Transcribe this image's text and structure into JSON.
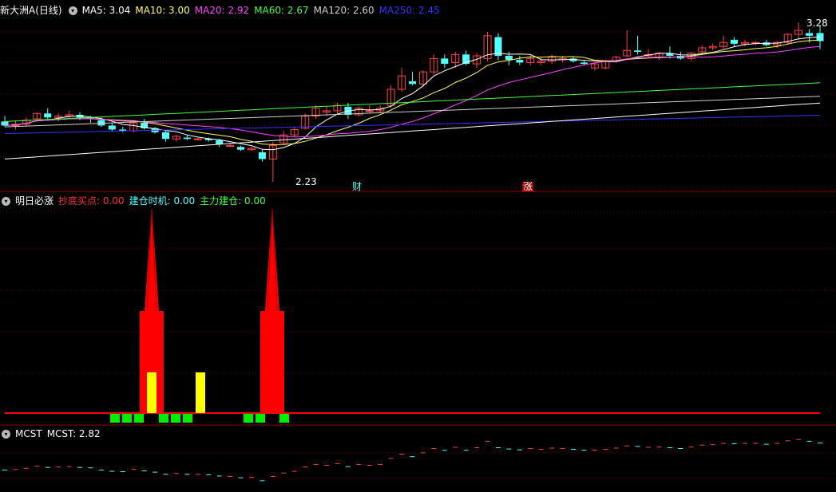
{
  "colors": {
    "bg": "#000000",
    "up": "#ff4444",
    "down": "#54ffff",
    "grid": "#6b0000",
    "ma5": "#ffffff",
    "ma10": "#ffff55",
    "ma20": "#ff44ff",
    "ma60": "#44ff44",
    "ma120": "#d0d0d0",
    "ma250": "#3333ff",
    "bar_red": "#ff0000",
    "bar_yellow": "#ffff00",
    "bar_green": "#00ee00"
  },
  "main": {
    "title": "新大洲A(日线)",
    "ma5": "MA5: 3.04",
    "ma10": "MA10: 3.00",
    "ma20": "MA20: 2.92",
    "ma60": "MA60: 2.67",
    "ma120": "MA120: 2.60",
    "ma250": "MA250: 2.45",
    "high_label": "3.28",
    "low_label": "2.23",
    "flag_cai": "财",
    "flag_zhang": "涨"
  },
  "indicator": {
    "title": "明日必涨",
    "chaodi": "抄底买点: 0.00",
    "jiancang": "建仓时机: 0.00",
    "zhuli": "主力建仓: 0.00"
  },
  "mcst": {
    "title": "MCST",
    "value": "MCST: 2.82"
  },
  "chart_data": {
    "type": "candlestick",
    "ohlc": [
      [
        2.68,
        2.72,
        2.64,
        2.65
      ],
      [
        2.65,
        2.69,
        2.62,
        2.66
      ],
      [
        2.66,
        2.71,
        2.64,
        2.69
      ],
      [
        2.7,
        2.75,
        2.68,
        2.74
      ],
      [
        2.74,
        2.78,
        2.7,
        2.71
      ],
      [
        2.71,
        2.74,
        2.68,
        2.72
      ],
      [
        2.72,
        2.76,
        2.7,
        2.73
      ],
      [
        2.73,
        2.75,
        2.69,
        2.71
      ],
      [
        2.71,
        2.72,
        2.67,
        2.7
      ],
      [
        2.69,
        2.71,
        2.64,
        2.65
      ],
      [
        2.65,
        2.67,
        2.61,
        2.62
      ],
      [
        2.62,
        2.64,
        2.6,
        2.61
      ],
      [
        2.61,
        2.68,
        2.6,
        2.67
      ],
      [
        2.67,
        2.7,
        2.62,
        2.63
      ],
      [
        2.63,
        2.64,
        2.59,
        2.6
      ],
      [
        2.6,
        2.61,
        2.53,
        2.55
      ],
      [
        2.55,
        2.58,
        2.53,
        2.57
      ],
      [
        2.56,
        2.58,
        2.54,
        2.55
      ],
      [
        2.55,
        2.56,
        2.54,
        2.55
      ],
      [
        2.55,
        2.56,
        2.53,
        2.54
      ],
      [
        2.54,
        2.55,
        2.49,
        2.51
      ],
      [
        2.5,
        2.52,
        2.49,
        2.5
      ],
      [
        2.49,
        2.5,
        2.46,
        2.47
      ],
      [
        2.47,
        2.49,
        2.46,
        2.48
      ],
      [
        2.45,
        2.47,
        2.38,
        2.4
      ],
      [
        2.4,
        2.53,
        2.23,
        2.5
      ],
      [
        2.52,
        2.61,
        2.51,
        2.58
      ],
      [
        2.58,
        2.64,
        2.56,
        2.62
      ],
      [
        2.63,
        2.74,
        2.62,
        2.72
      ],
      [
        2.72,
        2.8,
        2.7,
        2.78
      ],
      [
        2.75,
        2.79,
        2.72,
        2.76
      ],
      [
        2.76,
        2.82,
        2.74,
        2.8
      ],
      [
        2.79,
        2.82,
        2.7,
        2.73
      ],
      [
        2.73,
        2.79,
        2.72,
        2.78
      ],
      [
        2.76,
        2.8,
        2.74,
        2.76
      ],
      [
        2.76,
        2.8,
        2.74,
        2.78
      ],
      [
        2.8,
        2.95,
        2.78,
        2.92
      ],
      [
        2.92,
        3.08,
        2.9,
        3.02
      ],
      [
        2.98,
        3.05,
        2.95,
        2.96
      ],
      [
        2.96,
        3.06,
        2.94,
        3.05
      ],
      [
        3.05,
        3.18,
        3.03,
        3.15
      ],
      [
        3.15,
        3.18,
        3.08,
        3.11
      ],
      [
        3.12,
        3.2,
        3.08,
        3.18
      ],
      [
        3.18,
        3.21,
        3.1,
        3.11
      ],
      [
        3.11,
        3.19,
        3.08,
        3.17
      ],
      [
        3.15,
        3.35,
        3.13,
        3.32
      ],
      [
        3.31,
        3.34,
        3.14,
        3.17
      ],
      [
        3.17,
        3.2,
        3.1,
        3.14
      ],
      [
        3.14,
        3.17,
        3.1,
        3.12
      ],
      [
        3.12,
        3.18,
        3.1,
        3.15
      ],
      [
        3.12,
        3.16,
        3.1,
        3.13
      ],
      [
        3.13,
        3.18,
        3.11,
        3.16
      ],
      [
        3.14,
        3.17,
        3.12,
        3.15
      ],
      [
        3.15,
        3.16,
        3.12,
        3.13
      ],
      [
        3.12,
        3.14,
        3.1,
        3.11
      ],
      [
        3.08,
        3.12,
        3.06,
        3.11
      ],
      [
        3.08,
        3.14,
        3.07,
        3.13
      ],
      [
        3.13,
        3.17,
        3.12,
        3.16
      ],
      [
        3.17,
        3.36,
        3.16,
        3.21
      ],
      [
        3.21,
        3.32,
        3.18,
        3.2
      ],
      [
        3.17,
        3.22,
        3.15,
        3.18
      ],
      [
        3.16,
        3.2,
        3.14,
        3.19
      ],
      [
        3.19,
        3.24,
        3.15,
        3.17
      ],
      [
        3.17,
        3.2,
        3.14,
        3.15
      ],
      [
        3.15,
        3.2,
        3.13,
        3.19
      ],
      [
        3.2,
        3.25,
        3.18,
        3.23
      ],
      [
        3.23,
        3.26,
        3.21,
        3.24
      ],
      [
        3.24,
        3.32,
        3.22,
        3.27
      ],
      [
        3.29,
        3.31,
        3.24,
        3.26
      ],
      [
        3.26,
        3.29,
        3.24,
        3.27
      ],
      [
        3.27,
        3.28,
        3.25,
        3.27
      ],
      [
        3.27,
        3.29,
        3.24,
        3.25
      ],
      [
        3.25,
        3.28,
        3.23,
        3.27
      ],
      [
        3.27,
        3.34,
        3.25,
        3.33
      ],
      [
        3.33,
        3.42,
        3.29,
        3.36
      ],
      [
        3.34,
        3.37,
        3.27,
        3.32
      ],
      [
        3.34,
        3.4,
        3.22,
        3.28
      ]
    ]
  }
}
